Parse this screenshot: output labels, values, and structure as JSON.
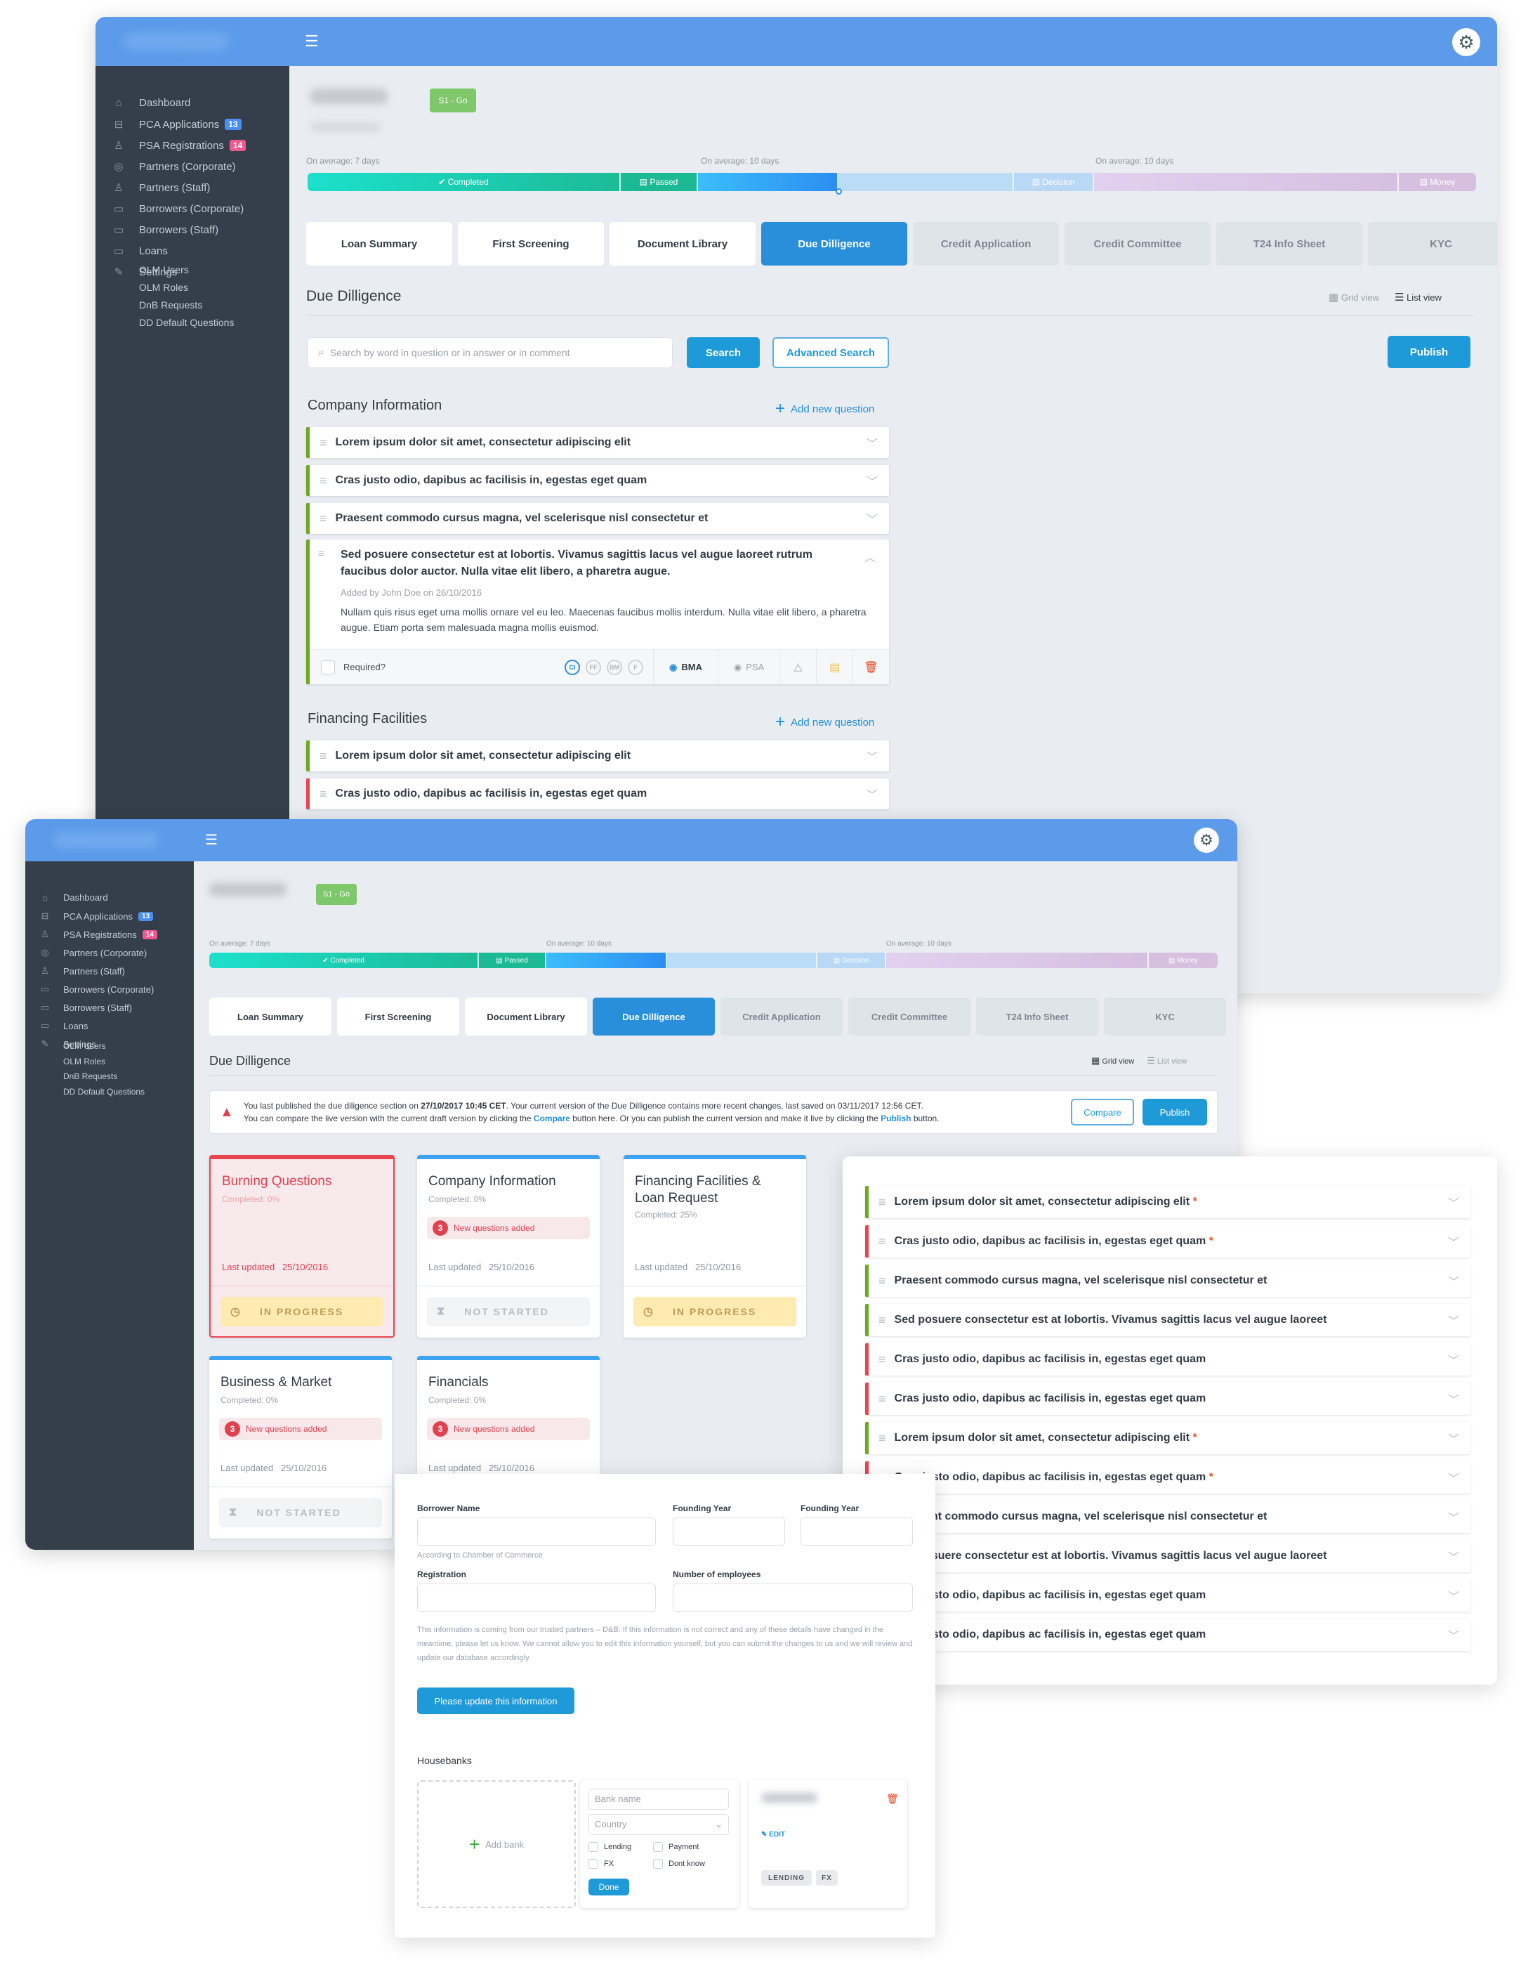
{
  "sidebar": {
    "items": [
      {
        "icon": "home-icon",
        "label": "Dashboard"
      },
      {
        "icon": "briefcase-icon",
        "label": "PCA Applications",
        "badge": "13"
      },
      {
        "icon": "user-add-icon",
        "label": "PSA Registrations",
        "badge": "14"
      },
      {
        "icon": "location-pin-icon",
        "label": "Partners (Corporate)"
      },
      {
        "icon": "users-icon",
        "label": "Partners (Staff)"
      },
      {
        "icon": "wallet-icon",
        "label": "Borrowers (Corporate)"
      },
      {
        "icon": "wallet-icon",
        "label": "Borrowers (Staff)"
      },
      {
        "icon": "wallet-icon",
        "label": "Loans"
      },
      {
        "icon": "edit-icon",
        "label": "Settings"
      }
    ],
    "sub_items": [
      "OLM Users",
      "OLM Roles",
      "DnB Requests",
      "DD Default Questions"
    ]
  },
  "header": {
    "stage_tag": "S1 - Go",
    "progress": {
      "averages": [
        "On average: 7 days",
        "On average: 10 days",
        "On average: 10 days"
      ],
      "segments": [
        {
          "label": "✔ Completed",
          "status": "completed"
        },
        {
          "label": "Passed",
          "status": "passed"
        },
        {
          "label": "",
          "status": "current"
        },
        {
          "label": "",
          "status": "upcoming"
        },
        {
          "label": "Decision",
          "status": "upcoming"
        },
        {
          "label": "",
          "status": "future"
        },
        {
          "label": "Money",
          "status": "future"
        }
      ]
    }
  },
  "tabs": [
    {
      "label": "Loan Summary",
      "state": "done"
    },
    {
      "label": "First Screening",
      "state": "done"
    },
    {
      "label": "Document Library",
      "state": "done"
    },
    {
      "label": "Due Dilligence",
      "state": "active"
    },
    {
      "label": "Credit Application",
      "state": "todo"
    },
    {
      "label": "Credit Committee",
      "state": "todo"
    },
    {
      "label": "T24 Info Sheet",
      "state": "todo"
    },
    {
      "label": "KYC",
      "state": "todo"
    }
  ],
  "main": {
    "title": "Due Dilligence",
    "grid_view": "Grid view",
    "list_view": "List view",
    "search_placeholder": "Search by word in question or in answer or in comment",
    "search_button": "Search",
    "advanced_search_button": "Advanced Search",
    "publish_button": "Publish",
    "add_question": "Add new question",
    "sections": [
      {
        "title": "Company Information",
        "questions": [
          {
            "text": "Lorem ipsum dolor sit amet, consectetur adipiscing elit",
            "status": "green"
          },
          {
            "text": "Cras justo odio, dapibus ac facilisis in, egestas eget quam",
            "status": "green"
          },
          {
            "text": "Praesent commodo cursus magna, vel scelerisque nisl consectetur et",
            "status": "green"
          }
        ],
        "expanded": {
          "text": "Sed posuere consectetur est at lobortis. Vivamus sagittis lacus vel augue laoreet rutrum faucibus dolor auctor. Nulla vitae elit libero, a pharetra augue.",
          "meta": "Added by John Doe on 26/10/2016",
          "answer": "Nullam quis risus eget urna mollis ornare vel eu leo. Maecenas faucibus mollis interdum. Nulla vitae elit libero, a pharetra augue. Etiam porta sem malesuada magna mollis euismod.",
          "required_label": "Required?",
          "required": false,
          "categories": [
            {
              "label": "CI",
              "active": true
            },
            {
              "label": "FF",
              "active": false
            },
            {
              "label": "BM",
              "active": false
            },
            {
              "label": "F",
              "active": false
            }
          ],
          "visibility": [
            {
              "label": "BMA",
              "active": true
            },
            {
              "label": "PSA",
              "active": false
            }
          ]
        }
      },
      {
        "title": "Financing Facilities",
        "questions": [
          {
            "text": "Lorem ipsum dolor sit amet, consectetur adipiscing elit",
            "status": "green"
          },
          {
            "text": "Cras justo odio, dapibus ac facilisis in, egestas eget quam",
            "status": "red"
          }
        ]
      }
    ]
  },
  "grid": {
    "alert": {
      "line1_a": "You last published the due diligence section on ",
      "line1_b": "27/10/2017 10:45 CET",
      "line1_c": ". Your current version of the Due Dilligence contains more recent changes, last saved on 03/11/2017 12:56 CET.",
      "line2_a": "You can compare the live version with the current draft version by clicking the ",
      "line2_b": "Compare",
      "line2_c": " button here. Or you can publish the current version and make it live by clicking the ",
      "line2_d": "Publish",
      "line2_e": " button.",
      "compare_button": "Compare",
      "publish_button": "Publish"
    },
    "cards": [
      {
        "title": "Burning Questions",
        "completed": "Completed: 0%",
        "new_count": null,
        "last_updated_label": "Last updated",
        "last_updated": "25/10/2016",
        "status": "IN PROGRESS",
        "variant": "burn"
      },
      {
        "title": "Company Information",
        "completed": "Completed: 0%",
        "new_count": "3",
        "new_label": "New questions added",
        "last_updated_label": "Last updated",
        "last_updated": "25/10/2016",
        "status": "NOT STARTED"
      },
      {
        "title": "Financing Facilities & Loan Request",
        "completed": "Completed: 25%",
        "new_count": null,
        "last_updated_label": "Last updated",
        "last_updated": "25/10/2016",
        "status": "IN PROGRESS"
      },
      {
        "title": "Business & Market",
        "completed": "Completed: 0%",
        "new_count": "3",
        "new_label": "New questions added",
        "last_updated_label": "Last updated",
        "last_updated": "25/10/2016",
        "status": "NOT STARTED"
      },
      {
        "title": "Financials",
        "completed": "Completed: 0%",
        "new_count": "3",
        "new_label": "New questions added",
        "last_updated_label": "Last updated",
        "last_updated": "25/10/2016"
      }
    ]
  },
  "list_panel": {
    "questions": [
      {
        "text": "Lorem ipsum dolor sit amet, consectetur adipiscing elit",
        "status": "green",
        "required": true
      },
      {
        "text": "Cras justo odio, dapibus ac facilisis in, egestas eget quam",
        "status": "red",
        "required": true
      },
      {
        "text": "Praesent commodo cursus magna, vel scelerisque nisl consectetur et",
        "status": "green",
        "required": false
      },
      {
        "text": "Sed posuere consectetur est at lobortis. Vivamus sagittis lacus vel augue laoreet",
        "status": "green",
        "required": false
      },
      {
        "text": "Cras justo odio, dapibus ac facilisis in, egestas eget quam",
        "status": "red",
        "required": false
      },
      {
        "text": "Cras justo odio, dapibus ac facilisis in, egestas eget quam",
        "status": "red",
        "required": false
      },
      {
        "text": "Lorem ipsum dolor sit amet, consectetur adipiscing elit",
        "status": "green",
        "required": true
      },
      {
        "text": "Cras justo odio, dapibus ac facilisis in, egestas eget quam",
        "status": "red",
        "required": true
      },
      {
        "text": "Praesent commodo cursus magna, vel scelerisque nisl consectetur et",
        "status": "red",
        "required": false
      },
      {
        "text": "Sed posuere consectetur est at lobortis. Vivamus sagittis lacus vel augue laoreet",
        "status": "red",
        "required": false
      },
      {
        "text": "Cras justo odio, dapibus ac facilisis in, egestas eget quam",
        "status": "red",
        "required": false
      },
      {
        "text": "Cras justo odio, dapibus ac facilisis in, egestas eget quam",
        "status": "red",
        "required": false
      }
    ]
  },
  "form_panel": {
    "borrower_name_label": "Borrower Name",
    "borrower_name_value": "",
    "borrower_name_hint": "According to Chamber of Commerce",
    "founding_year_label_1": "Founding Year",
    "founding_year_label_2": "Founding Year",
    "registration_label": "Registration",
    "employees_label": "Number of employees",
    "info_text": "This information is coming from our trusted partners – D&B. If this information is not correct and any of these details have changed in the meantime, please let us know. We cannot allow you to edit this information yourself, but you can submit the changes to us and we will review and update our database accordingly.",
    "update_button": "Please update this information",
    "housebanks_title": "Housebanks",
    "add_bank": "Add bank",
    "bank_name_placeholder": "Bank name",
    "country_placeholder": "Country",
    "options": [
      "Lending",
      "Payment",
      "FX",
      "Dont know"
    ],
    "done_button": "Done",
    "edit_label": "EDIT",
    "bank_tags": [
      "LENDING",
      "FX"
    ]
  },
  "colors": {
    "topbar": "#5b9bea",
    "sidebar": "#353f4b",
    "primary": "#1f9ad8",
    "green_status": "#6fa81e",
    "red_status": "#e84550"
  }
}
